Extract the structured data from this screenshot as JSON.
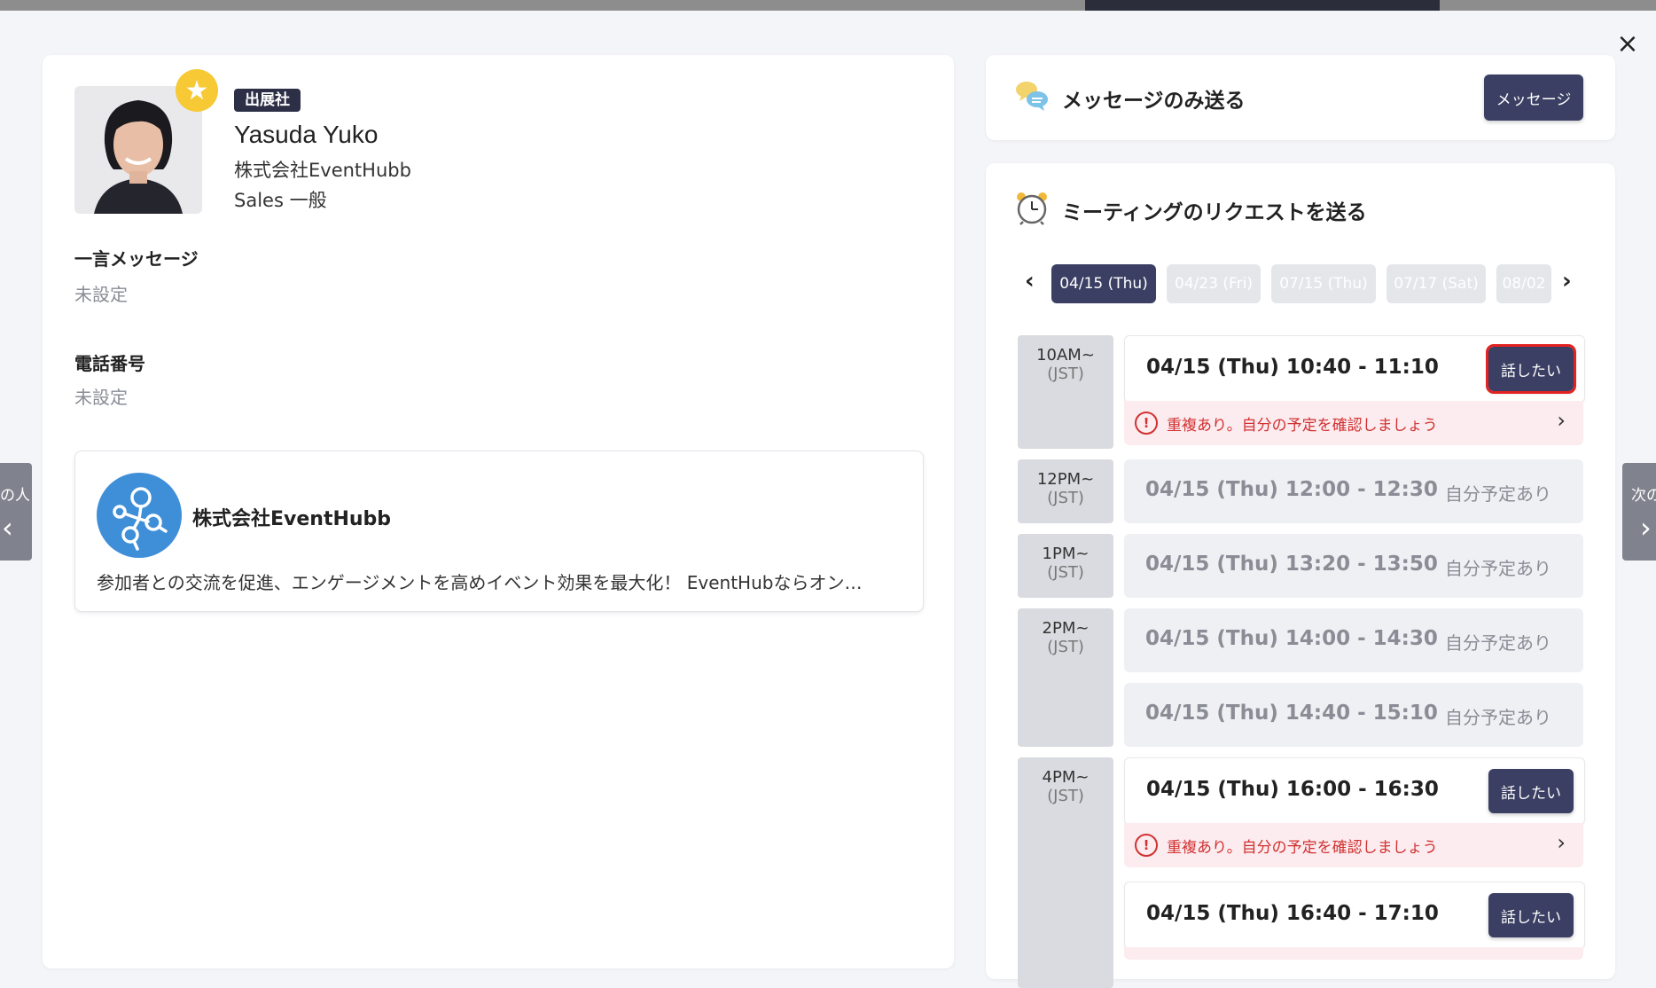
{
  "window": {
    "close_icon": "×"
  },
  "profile": {
    "badge": "出展社",
    "name": "Yasuda Yuko",
    "company": "株式会社EventHubb",
    "role": "Sales 一般",
    "message_label": "一言メッセージ",
    "message_value": "未設定",
    "phone_label": "電話番号",
    "phone_value": "未設定"
  },
  "company_card": {
    "name": "株式会社EventHubb",
    "description": "参加者との交流を促進、エンゲージメントを高めイベント効果を最大化！ EventHubならオン…"
  },
  "nav": {
    "prev_label": "の人",
    "next_label": "次の",
    "prev_icon": "‹",
    "next_icon": "›"
  },
  "message_section": {
    "title": "メッセージのみ送る",
    "button": "メッセージ"
  },
  "meeting_section": {
    "title": "ミーティングのリクエストを送る",
    "prev_icon": "‹",
    "next_icon": "›",
    "dates": [
      "04/15 (Thu)",
      "04/23 (Fri)",
      "07/15 (Thu)",
      "07/17 (Sat)",
      "08/02"
    ],
    "time_groups": [
      {
        "label": "10AM~",
        "tz": "(JST)"
      },
      {
        "label": "12PM~",
        "tz": "(JST)"
      },
      {
        "label": "1PM~",
        "tz": "(JST)"
      },
      {
        "label": "2PM~",
        "tz": "(JST)"
      },
      {
        "label": "4PM~",
        "tz": "(JST)"
      }
    ],
    "slots": [
      {
        "time": "04/15 (Thu) 10:40 - 11:10",
        "button": "話したい"
      },
      {
        "time": "04/15 (Thu) 12:00 - 12:30",
        "status": "自分予定あり"
      },
      {
        "time": "04/15 (Thu) 13:20 - 13:50",
        "status": "自分予定あり"
      },
      {
        "time": "04/15 (Thu) 14:00 - 14:30",
        "status": "自分予定あり"
      },
      {
        "time": "04/15 (Thu) 14:40 - 15:10",
        "status": "自分予定あり"
      },
      {
        "time": "04/15 (Thu) 16:00 - 16:30",
        "button": "話したい"
      },
      {
        "time": "04/15 (Thu) 16:40 - 17:10",
        "button": "話したい"
      }
    ],
    "warning": "重複あり。自分の予定を確認しましょう",
    "warning_chevron": "›"
  }
}
